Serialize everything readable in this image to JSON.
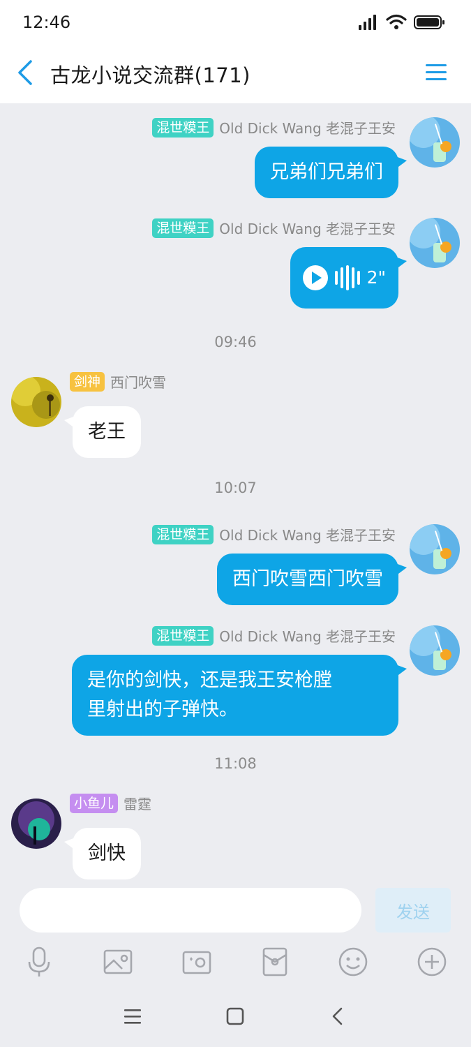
{
  "status_bar": {
    "time": "12:46"
  },
  "header": {
    "title": "古龙小说交流群(171)"
  },
  "messages": [
    {
      "badge": "混世糢王",
      "sender": "Old Dick Wang 老混子王安",
      "text": "兄弟们兄弟们"
    },
    {
      "badge": "混世糢王",
      "sender": "Old Dick Wang 老混子王安",
      "voice_duration": "2\""
    },
    {
      "time": "09:46"
    },
    {
      "badge": "剑神",
      "sender": "西门吹雪",
      "text": "老王"
    },
    {
      "time": "10:07"
    },
    {
      "badge": "混世糢王",
      "sender": "Old Dick Wang 老混子王安",
      "text": "西门吹雪西门吹雪"
    },
    {
      "badge": "混世糢王",
      "sender": "Old Dick Wang 老混子王安",
      "text_line1": "是你的剑快，还是我王安枪膛",
      "text_line2": "里射出的子弹快。"
    },
    {
      "time": "11:08"
    },
    {
      "badge": "小鱼儿",
      "sender": "雷霆",
      "text": "剑快"
    }
  ],
  "input": {
    "value": "",
    "placeholder": "",
    "send_label": "发送"
  },
  "colors": {
    "accent": "#0ea5e6",
    "background": "#ecedf1",
    "badge_teal": "#3fd2c4",
    "badge_gold": "#f7c240",
    "badge_purple": "#c58ef0"
  },
  "tools": [
    "microphone-icon",
    "image-icon",
    "camera-icon",
    "red-packet-icon",
    "emoji-icon",
    "plus-icon"
  ]
}
